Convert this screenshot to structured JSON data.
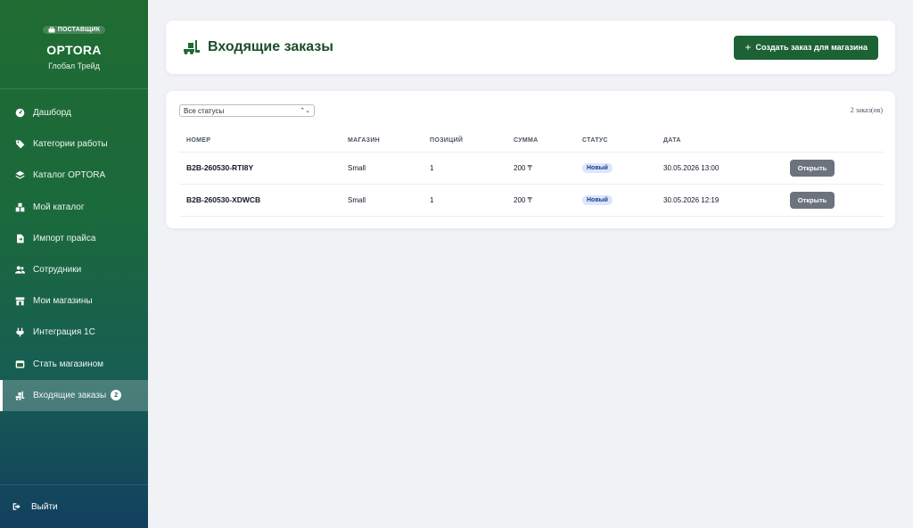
{
  "sidebar": {
    "role_badge": "ПОСТАВЩИК",
    "brand_name": "OPTORA",
    "company": "Глобал Трейд",
    "items": [
      {
        "label": "Дашборд",
        "icon": "dashboard-icon"
      },
      {
        "label": "Категории работы",
        "icon": "tags-icon"
      },
      {
        "label": "Каталог OPTORA",
        "icon": "layers-icon"
      },
      {
        "label": "Мой каталог",
        "icon": "boxes-icon"
      },
      {
        "label": "Импорт прайса",
        "icon": "file-import-icon"
      },
      {
        "label": "Сотрудники",
        "icon": "users-icon"
      },
      {
        "label": "Мои магазины",
        "icon": "store-icon"
      },
      {
        "label": "Интеграция 1С",
        "icon": "plug-icon"
      },
      {
        "label": "Стать магазином",
        "icon": "shop-icon"
      },
      {
        "label": "Входящие заказы",
        "icon": "truck-loading-icon",
        "active": true,
        "badge": "2"
      }
    ],
    "logout_label": "Выйти"
  },
  "header": {
    "title": "Входящие заказы",
    "create_button": "Создать заказ для магазина"
  },
  "filters": {
    "status_selected": "Все статусы",
    "count_text": "2 заказ(ов)"
  },
  "table": {
    "columns": [
      "НОМЕР",
      "МАГАЗИН",
      "ПОЗИЦИЙ",
      "СУММА",
      "СТАТУС",
      "ДАТА"
    ],
    "rows": [
      {
        "number": "B2B-260530-RTI8Y",
        "store": "Small",
        "positions": "1",
        "sum": "200 ₸",
        "status": "Новый",
        "date": "30.05.2026 13:00",
        "action": "Открыть"
      },
      {
        "number": "B2B-260530-XDWCB",
        "store": "Small",
        "positions": "1",
        "sum": "200 ₸",
        "status": "Новый",
        "date": "30.05.2026 12:19",
        "action": "Открыть"
      }
    ]
  },
  "colors": {
    "brand_green": "#1d6234",
    "badge_bg": "#dbe7fb",
    "open_button": "#6c737d"
  }
}
